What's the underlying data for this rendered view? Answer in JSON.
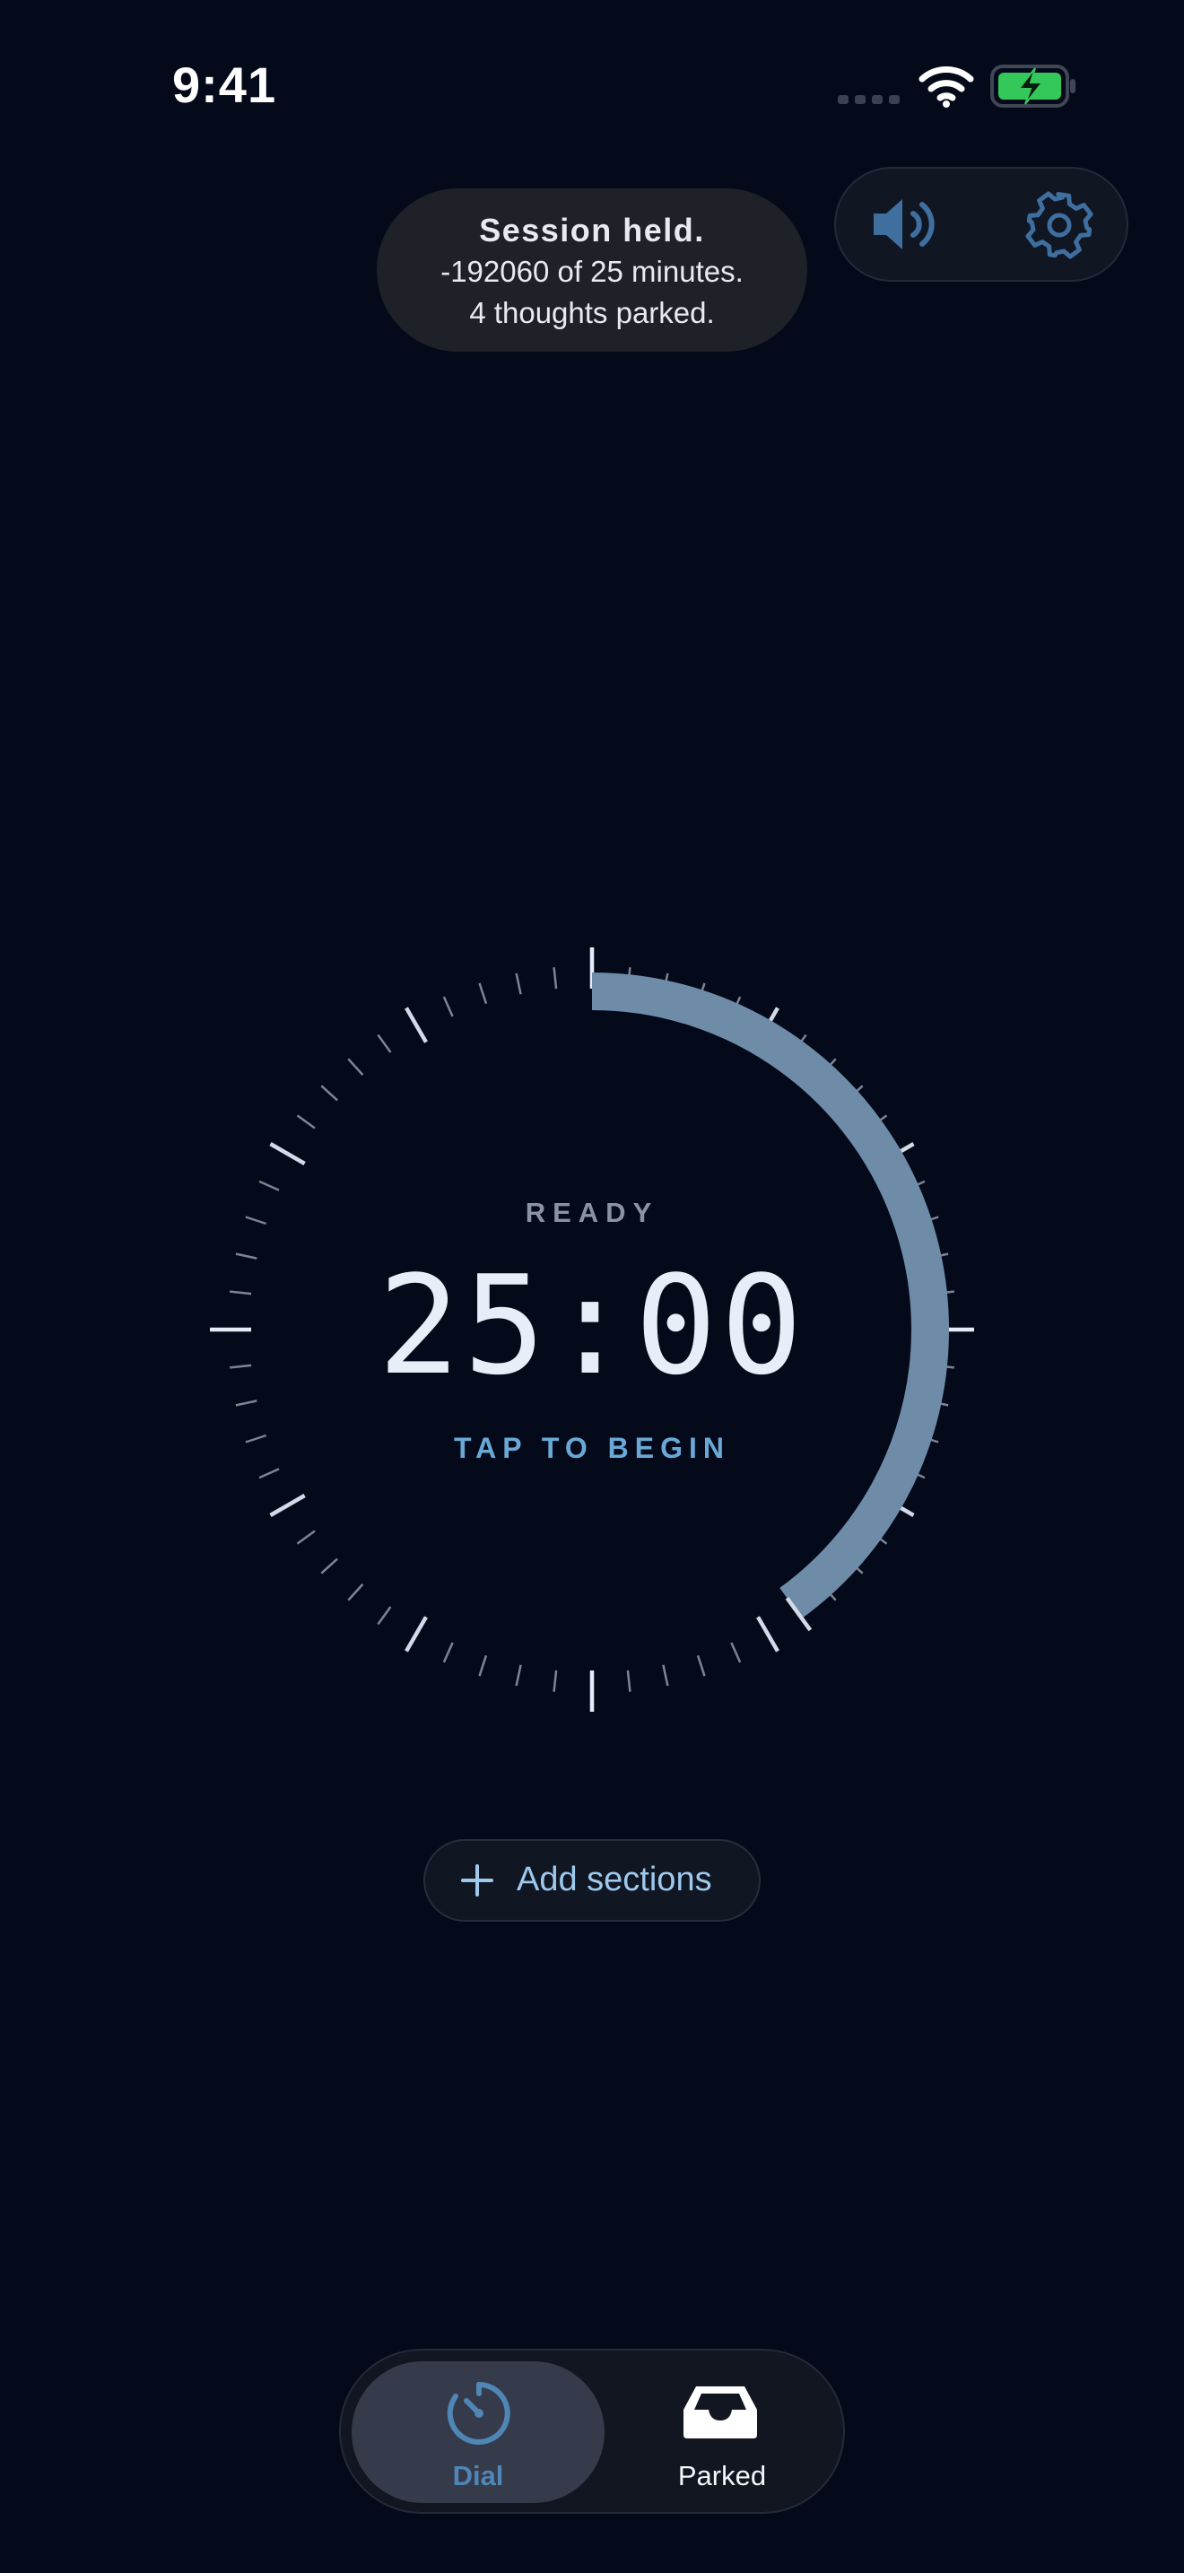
{
  "status_bar": {
    "time": "9:41",
    "icons": [
      "cellular-signal-icon",
      "wifi-icon",
      "battery-charging-icon"
    ]
  },
  "toast": {
    "title": "Session held.",
    "line1": "-192060 of 25 minutes.",
    "line2": "4 thoughts parked."
  },
  "controls": {
    "sound_icon": "speaker-icon",
    "settings_icon": "gear-icon"
  },
  "dial": {
    "state": "READY",
    "time_display": "25:00",
    "hint": "TAP TO BEGIN",
    "progress_arc_fraction": 0.4,
    "tick_count": 60
  },
  "add_sections": {
    "label": "Add sections",
    "icon": "plus-icon"
  },
  "tabbar": {
    "tabs": [
      {
        "label": "Dial",
        "icon": "timer-dial-icon",
        "active": true
      },
      {
        "label": "Parked",
        "icon": "inbox-tray-icon",
        "active": false
      }
    ]
  },
  "colors": {
    "background": "#050a1b",
    "arc": "#6e8ca8",
    "accent": "#6aa9d6",
    "battery": "#34c759"
  }
}
